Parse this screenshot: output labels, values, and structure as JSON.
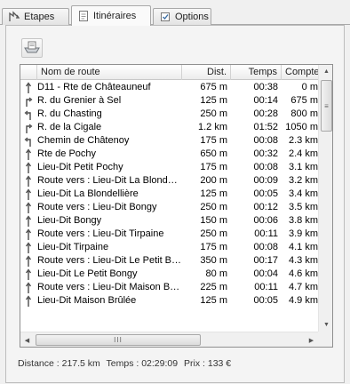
{
  "tabs": [
    {
      "label": "Etapes",
      "icon": "map-arrows-icon"
    },
    {
      "label": "Itinéraires",
      "icon": "document-icon"
    },
    {
      "label": "Options",
      "icon": "options-checkbox-icon"
    }
  ],
  "toolbar": {
    "export_icon": "export-tray-icon"
  },
  "table": {
    "columns": [
      "Nom de route",
      "Dist.",
      "Temps",
      "Compteur"
    ],
    "rows": [
      {
        "name": "D11 - Rte de Châteauneuf",
        "dist": "675 m",
        "time": "00:38",
        "count": "0 m",
        "dir": "straight"
      },
      {
        "name": "R. du Grenier à Sel",
        "dist": "125 m",
        "time": "00:14",
        "count": "675 m",
        "dir": "right"
      },
      {
        "name": "R. du Chasting",
        "dist": "250 m",
        "time": "00:28",
        "count": "800 m",
        "dir": "left"
      },
      {
        "name": "R. de la Cigale",
        "dist": "1.2 km",
        "time": "01:52",
        "count": "1050 m",
        "dir": "right"
      },
      {
        "name": "Chemin de Châtenoy",
        "dist": "175 m",
        "time": "00:08",
        "count": "2.3 km",
        "dir": "left"
      },
      {
        "name": "Rte de Pochy",
        "dist": "650 m",
        "time": "00:32",
        "count": "2.4 km",
        "dir": "straight"
      },
      {
        "name": "Lieu-Dit Petit Pochy",
        "dist": "175 m",
        "time": "00:08",
        "count": "3.1 km",
        "dir": "straight"
      },
      {
        "name": "Route vers : Lieu-Dit La Blondellière",
        "dist": "200 m",
        "time": "00:09",
        "count": "3.2 km",
        "dir": "straight"
      },
      {
        "name": "Lieu-Dit La Blondellière",
        "dist": "125 m",
        "time": "00:05",
        "count": "3.4 km",
        "dir": "straight"
      },
      {
        "name": "Route vers : Lieu-Dit Bongy",
        "dist": "250 m",
        "time": "00:12",
        "count": "3.5 km",
        "dir": "straight"
      },
      {
        "name": "Lieu-Dit Bongy",
        "dist": "150 m",
        "time": "00:06",
        "count": "3.8 km",
        "dir": "straight"
      },
      {
        "name": "Route vers : Lieu-Dit Tirpaine",
        "dist": "250 m",
        "time": "00:11",
        "count": "3.9 km",
        "dir": "straight"
      },
      {
        "name": "Lieu-Dit Tirpaine",
        "dist": "175 m",
        "time": "00:08",
        "count": "4.1 km",
        "dir": "straight"
      },
      {
        "name": "Route vers : Lieu-Dit Le Petit Bongy",
        "dist": "350 m",
        "time": "00:17",
        "count": "4.3 km",
        "dir": "straight"
      },
      {
        "name": "Lieu-Dit Le Petit Bongy",
        "dist": "80 m",
        "time": "00:04",
        "count": "4.6 km",
        "dir": "straight"
      },
      {
        "name": "Route vers : Lieu-Dit Maison Brûlée",
        "dist": "225 m",
        "time": "00:11",
        "count": "4.7 km",
        "dir": "straight"
      },
      {
        "name": "Lieu-Dit Maison Brûlée",
        "dist": "125 m",
        "time": "00:05",
        "count": "4.9 km",
        "dir": "straight"
      }
    ]
  },
  "status": {
    "distance": "Distance : 217.5 km",
    "time": "Temps : 02:29:09",
    "price": "Prix : 133 €"
  },
  "colors": {
    "accent": "#3b6ea5",
    "arrow": "#4a4a4a"
  }
}
